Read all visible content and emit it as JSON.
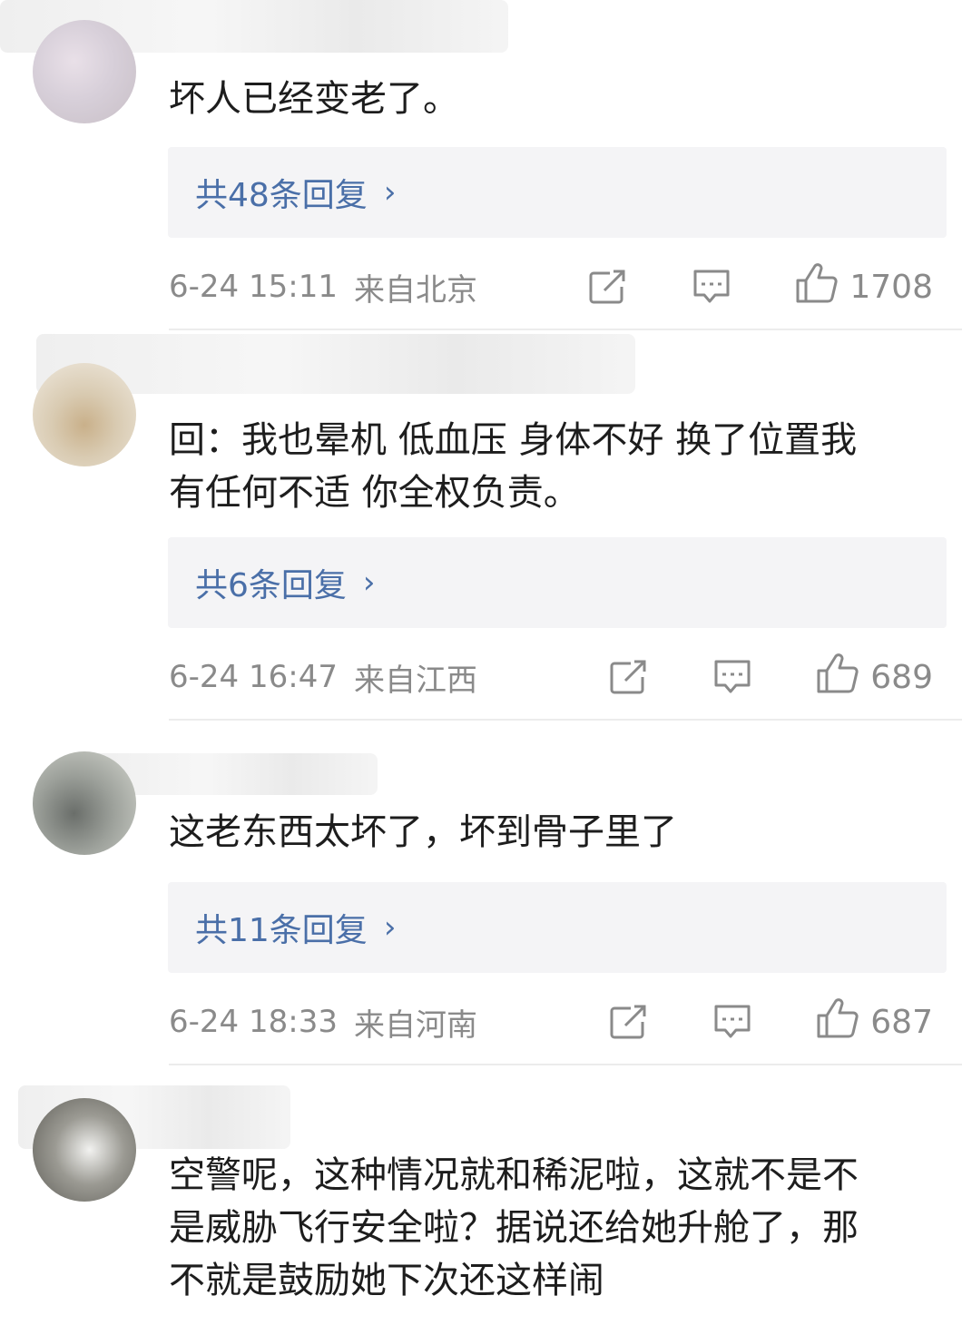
{
  "comments": [
    {
      "text": "坏人已经变老了。",
      "reply_label": "共48条回复",
      "chevron": "›",
      "time": "6-24 15:11",
      "location": "来自北京",
      "likes": "1708"
    },
    {
      "text": "回：我也晕机 低血压 身体不好 换了位置我\n有任何不适 你全权负责。",
      "reply_label": "共6条回复",
      "chevron": "›",
      "time": "6-24 16:47",
      "location": "来自江西",
      "likes": "689"
    },
    {
      "text": "这老东西太坏了，坏到骨子里了",
      "reply_label": "共11条回复",
      "chevron": "›",
      "time": "6-24 18:33",
      "location": "来自河南",
      "likes": "687"
    },
    {
      "text": "空警呢，这种情况就和稀泥啦，这就不是不\n是威胁飞行安全啦？据说还给她升舱了，那\n不就是鼓励她下次还这样闹"
    }
  ],
  "icons": {
    "share": "share-icon",
    "comment": "comment-icon",
    "like": "thumbs-up-icon"
  },
  "colors": {
    "link": "#4a6fa8",
    "meta": "#8a8a8a",
    "reply_bg": "#f4f4f6"
  }
}
